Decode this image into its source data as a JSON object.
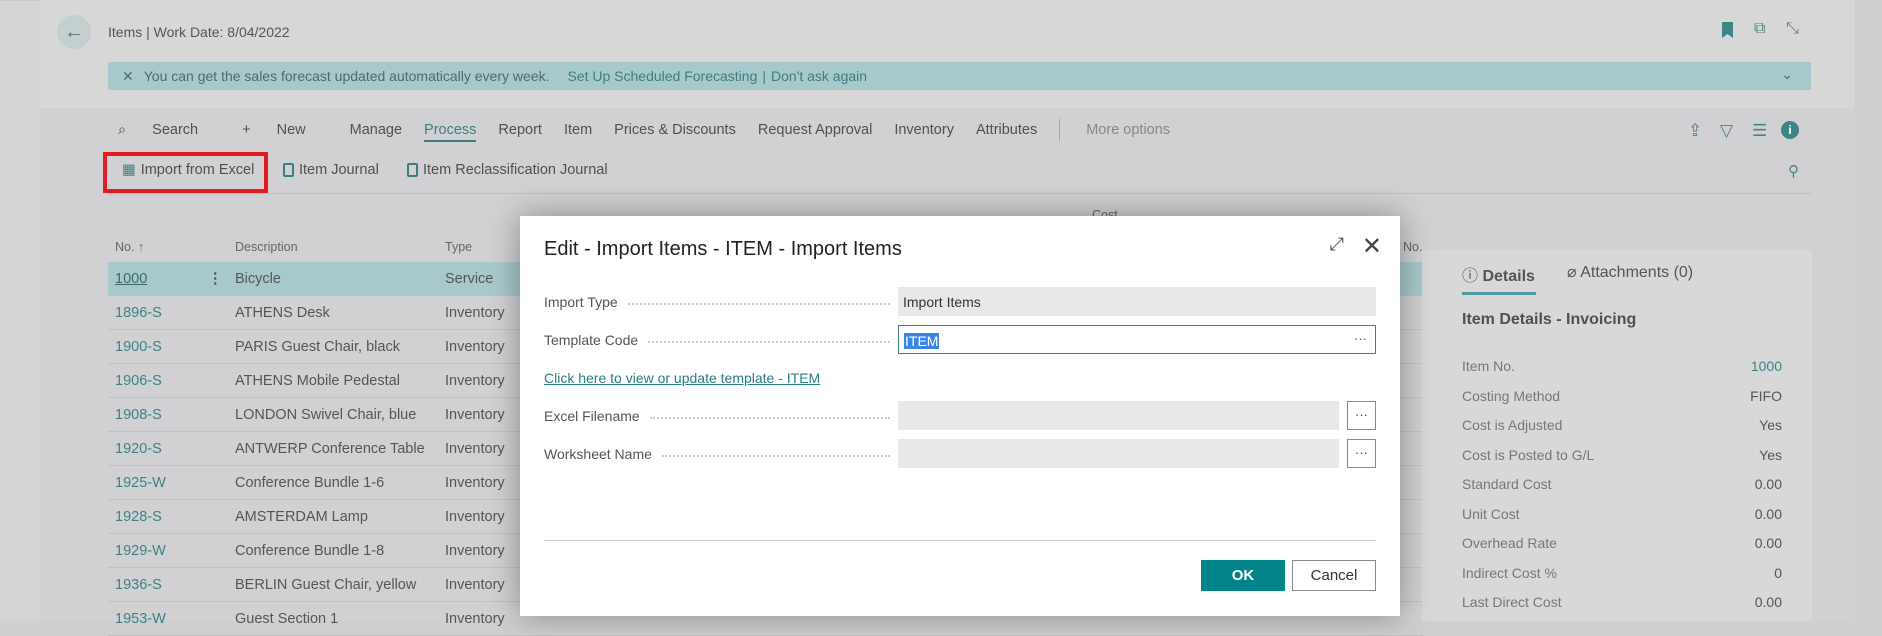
{
  "header": {
    "title": "Items | Work Date: 8/04/2022"
  },
  "notification": {
    "text": "You can get the sales forecast updated automatically every week.",
    "link1": "Set Up Scheduled Forecasting",
    "separator": "|",
    "link2": "Don't ask again"
  },
  "menu": {
    "items": [
      "Search",
      "New",
      "Manage",
      "Process",
      "Report",
      "Item",
      "Prices & Discounts",
      "Request Approval",
      "Inventory",
      "Attributes"
    ],
    "active": "Process",
    "more": "More options"
  },
  "subactions": [
    "Import from Excel",
    "Item Journal",
    "Item Reclassification Journal"
  ],
  "table": {
    "headers": {
      "no": "No. ↑",
      "description": "Description",
      "type": "Type",
      "cost": "Cost",
      "no2": "No."
    },
    "rows": [
      {
        "no": "1000",
        "description": "Bicycle",
        "type": "Service"
      },
      {
        "no": "1896-S",
        "description": "ATHENS Desk",
        "type": "Inventory"
      },
      {
        "no": "1900-S",
        "description": "PARIS Guest Chair, black",
        "type": "Inventory"
      },
      {
        "no": "1906-S",
        "description": "ATHENS Mobile Pedestal",
        "type": "Inventory"
      },
      {
        "no": "1908-S",
        "description": "LONDON Swivel Chair, blue",
        "type": "Inventory"
      },
      {
        "no": "1920-S",
        "description": "ANTWERP Conference Table",
        "type": "Inventory"
      },
      {
        "no": "1925-W",
        "description": "Conference Bundle 1-6",
        "type": "Inventory"
      },
      {
        "no": "1928-S",
        "description": "AMSTERDAM Lamp",
        "type": "Inventory"
      },
      {
        "no": "1929-W",
        "description": "Conference Bundle 1-8",
        "type": "Inventory"
      },
      {
        "no": "1936-S",
        "description": "BERLIN Guest Chair, yellow",
        "type": "Inventory"
      },
      {
        "no": "1953-W",
        "description": "Guest Section 1",
        "type": "Inventory"
      }
    ]
  },
  "factbox": {
    "tabs": [
      "Details",
      "Attachments (0)"
    ],
    "heading": "Item Details - Invoicing",
    "fields": [
      {
        "label": "Item No.",
        "value": "1000"
      },
      {
        "label": "Costing Method",
        "value": "FIFO"
      },
      {
        "label": "Cost is Adjusted",
        "value": "Yes"
      },
      {
        "label": "Cost is Posted to G/L",
        "value": "Yes"
      },
      {
        "label": "Standard Cost",
        "value": "0.00"
      },
      {
        "label": "Unit Cost",
        "value": "0.00"
      },
      {
        "label": "Overhead Rate",
        "value": "0.00"
      },
      {
        "label": "Indirect Cost %",
        "value": "0"
      },
      {
        "label": "Last Direct Cost",
        "value": "0.00"
      }
    ]
  },
  "dialog": {
    "title": "Edit - Import Items - ITEM - Import Items",
    "import_type_label": "Import Type",
    "import_type_value": "Import Items",
    "template_code_label": "Template Code",
    "template_code_value": "ITEM",
    "link": "Click here to view or update template - ITEM",
    "excel_filename_label": "Excel Filename",
    "excel_filename_value": "",
    "worksheet_name_label": "Worksheet Name",
    "worksheet_name_value": "",
    "ellipsis": "···",
    "ok": "OK",
    "cancel": "Cancel"
  },
  "colors": {
    "accent": "#008489",
    "notification": "#a8c9cb",
    "highlight": "#e01b24",
    "selection": "#3a86e8"
  }
}
